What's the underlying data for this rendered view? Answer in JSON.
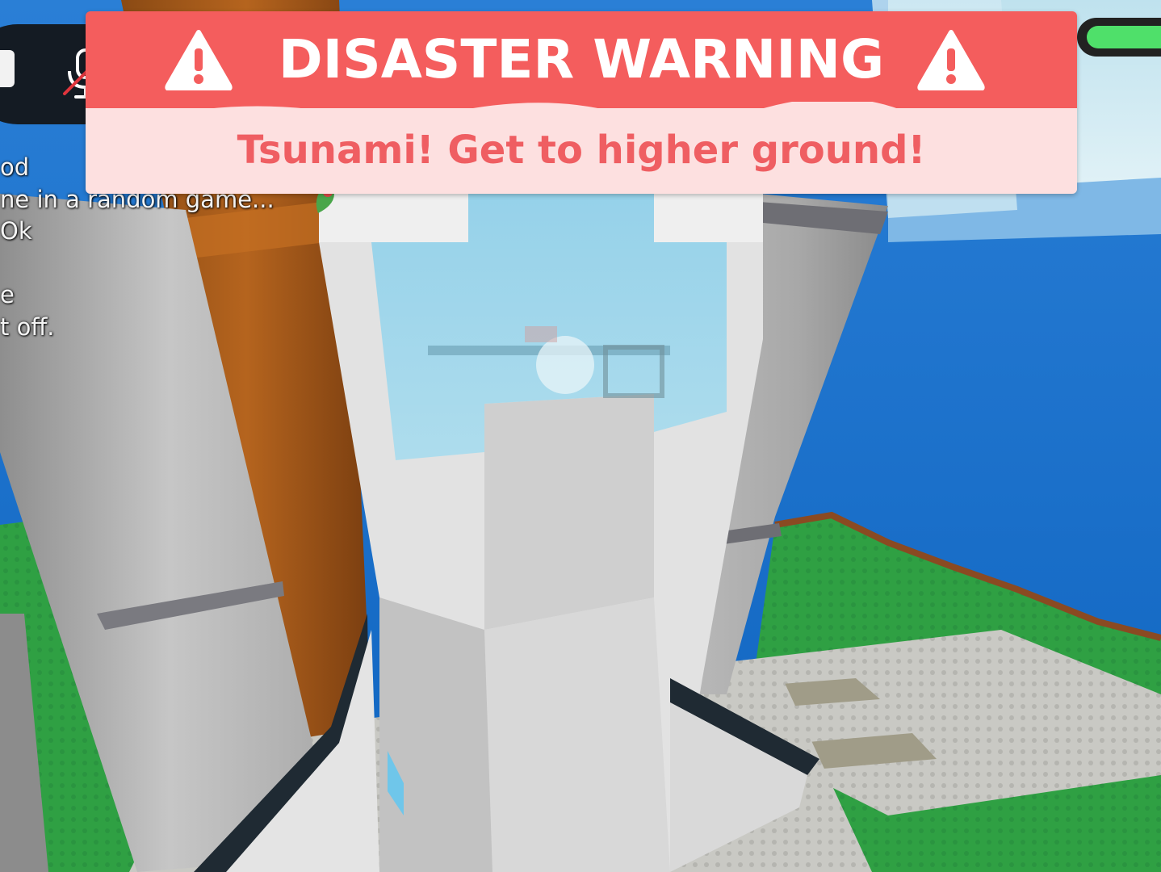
{
  "hud": {
    "health": 1.0,
    "mic_muted": true
  },
  "banner": {
    "title": "DISASTER WARNING",
    "message": "Tsunami! Get to higher ground!",
    "colors": {
      "header": "#f45d5d",
      "body": "#fde0e0",
      "message_text": "#ef5e62"
    }
  },
  "chat": {
    "lines": [
      "od",
      "ne in a random game...",
      "Ok",
      "",
      "e",
      "t off."
    ]
  }
}
